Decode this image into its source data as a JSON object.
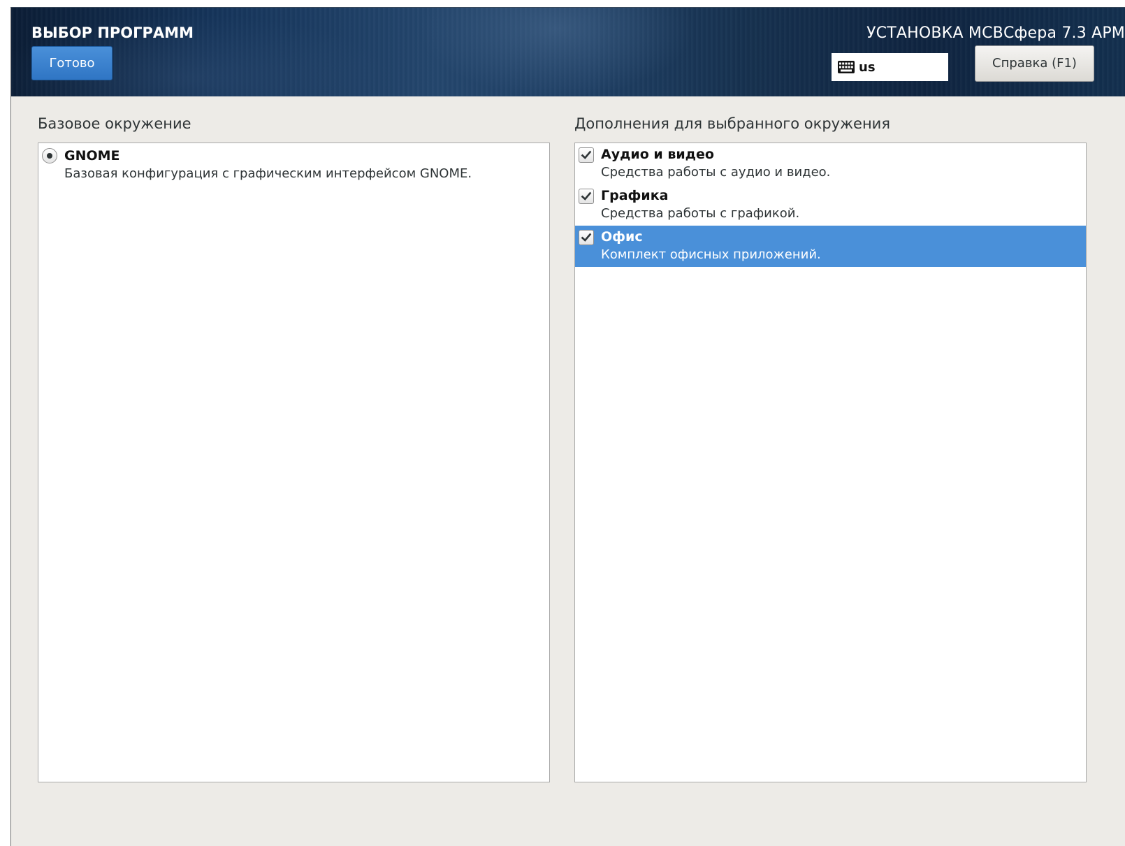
{
  "header": {
    "spoke_title": "ВЫБОР ПРОГРАММ",
    "done_label": "Готово",
    "product_title": "УСТАНОВКА МСВСфера 7.3 АРМ",
    "keyboard_icon": "keyboard-icon",
    "keyboard_layout": "us",
    "help_label": "Справка (F1)"
  },
  "base_environment": {
    "label": "Базовое окружение",
    "items": [
      {
        "title": "GNOME",
        "description": "Базовая конфигурация с графическим интерфейсом GNOME.",
        "selected": true
      }
    ]
  },
  "addons": {
    "label": "Дополнения для выбранного окружения",
    "items": [
      {
        "title": "Аудио и видео",
        "description": "Средства работы с аудио и видео.",
        "checked": true,
        "highlighted": false
      },
      {
        "title": "Графика",
        "description": "Средства работы с графикой.",
        "checked": true,
        "highlighted": false
      },
      {
        "title": "Офис",
        "description": "Комплект офисных приложений.",
        "checked": true,
        "highlighted": true
      }
    ]
  },
  "colors": {
    "accent": "#4a90d9",
    "header_dark": "#0b1d35",
    "background": "#edebe7"
  }
}
